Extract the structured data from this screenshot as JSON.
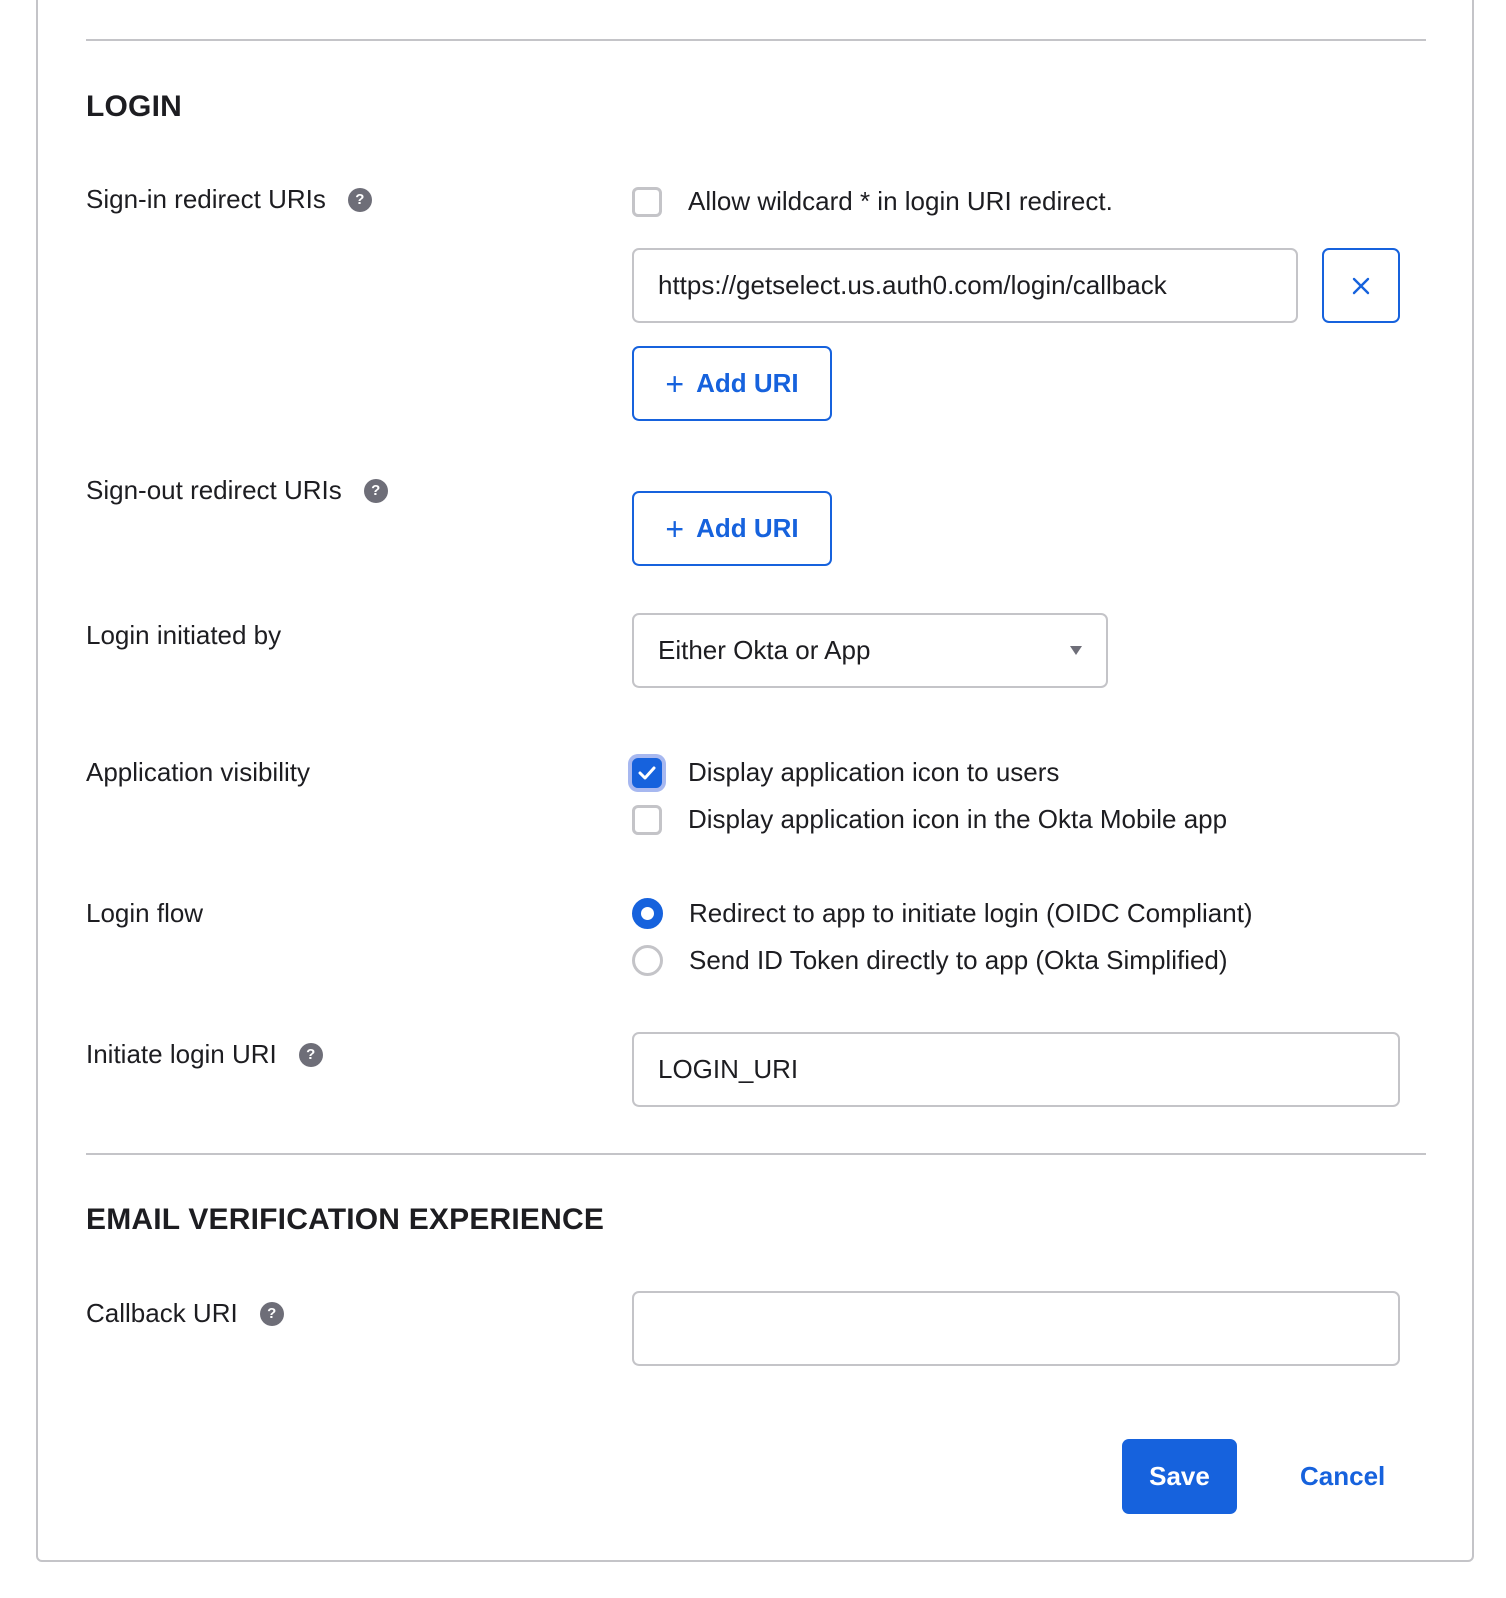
{
  "login": {
    "section_title": "LOGIN",
    "sign_in": {
      "label": "Sign-in redirect URIs",
      "help_icon": "question-circle-icon",
      "wildcard_label": "Allow wildcard * in login URI redirect.",
      "wildcard_checked": false,
      "uris": [
        "https://getselect.us.auth0.com/login/callback"
      ],
      "remove_icon": "close-icon",
      "add_label": "Add URI",
      "add_icon": "plus-icon"
    },
    "sign_out": {
      "label": "Sign-out redirect URIs",
      "help_icon": "question-circle-icon",
      "add_label": "Add URI",
      "add_icon": "plus-icon"
    },
    "initiated_by": {
      "label": "Login initiated by",
      "selected": "Either Okta or App",
      "caret_icon": "caret-down-icon"
    },
    "visibility": {
      "label": "Application visibility",
      "options": [
        {
          "label": "Display application icon to users",
          "checked": true
        },
        {
          "label": "Display application icon in the Okta Mobile app",
          "checked": false
        }
      ]
    },
    "flow": {
      "label": "Login flow",
      "options": [
        {
          "label": "Redirect to app to initiate login (OIDC Compliant)",
          "selected": true
        },
        {
          "label": "Send ID Token directly to app (Okta Simplified)",
          "selected": false
        }
      ]
    },
    "initiate_uri": {
      "label": "Initiate login URI",
      "help_icon": "question-circle-icon",
      "value": "LOGIN_URI"
    }
  },
  "email_verification": {
    "section_title": "EMAIL VERIFICATION EXPERIENCE",
    "callback": {
      "label": "Callback URI",
      "help_icon": "question-circle-icon",
      "value": ""
    }
  },
  "actions": {
    "save_label": "Save",
    "cancel_label": "Cancel"
  },
  "colors": {
    "accent": "#1662dd",
    "border": "#c4c4c8",
    "text": "#1d1d21",
    "help_icon": "#6e6e78"
  }
}
